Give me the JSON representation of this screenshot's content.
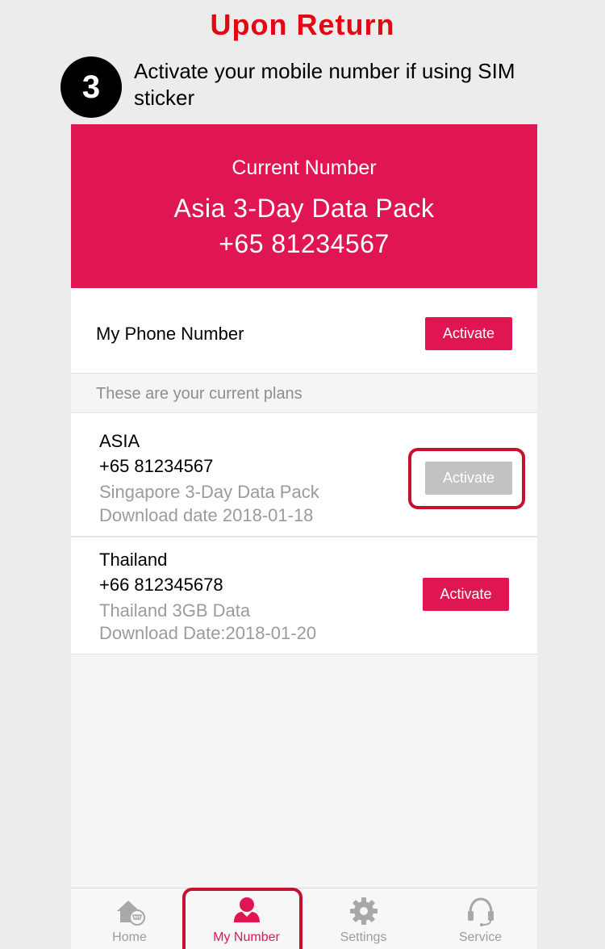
{
  "heading": "Upon Return",
  "step": {
    "number": "3",
    "text": "Activate your mobile number if using SIM sticker"
  },
  "hero": {
    "label": "Current Number",
    "plan": "Asia 3-Day Data Pack",
    "number": "+65 81234567"
  },
  "my_phone": {
    "label": "My Phone Number",
    "button": "Activate"
  },
  "plans_caption": "These are your current plans",
  "plans": [
    {
      "region": "ASIA",
      "number": "+65 81234567",
      "plan_name": "Singapore 3-Day Data Pack",
      "download": "Download date 2018-01-18",
      "button": "Activate",
      "button_state": "disabled"
    },
    {
      "region": "Thailand",
      "number": "+66 812345678",
      "plan_name": "Thailand 3GB Data",
      "download": "Download Date:2018-01-20",
      "button": "Activate",
      "button_state": "enabled"
    }
  ],
  "tabs": [
    {
      "label": "Home",
      "icon": "home-cart-icon",
      "active": false
    },
    {
      "label": "My Number",
      "icon": "person-icon",
      "active": true
    },
    {
      "label": "Settings",
      "icon": "gear-icon",
      "active": false
    },
    {
      "label": "Service",
      "icon": "headset-icon",
      "active": false
    }
  ],
  "colors": {
    "accent": "#df1651",
    "heading": "#e30613",
    "highlight": "#c41231",
    "disabled": "#c2c2c2"
  }
}
